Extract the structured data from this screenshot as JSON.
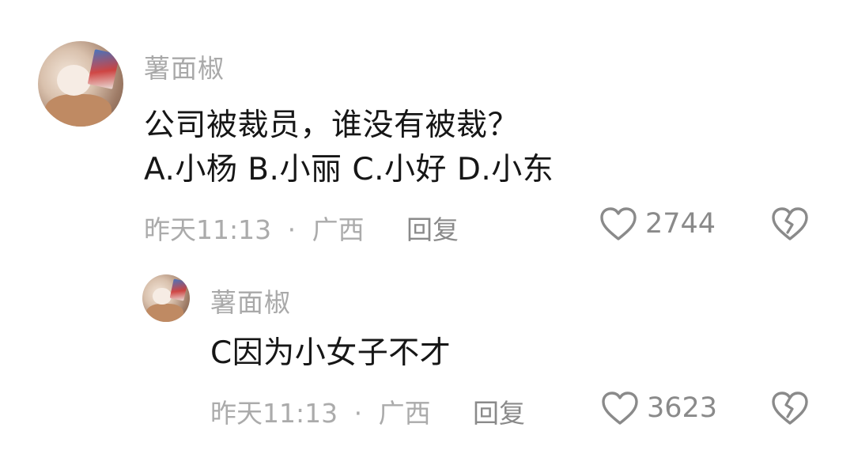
{
  "comments": [
    {
      "username": "薯面椒",
      "text_lines": [
        "公司被裁员，谁没有被裁？",
        "A.小杨 B.小丽 C.小好 D.小东"
      ],
      "time": "昨天11:13",
      "separator": "·",
      "location": "广西",
      "reply_label": "回复",
      "like_count": "2744"
    }
  ],
  "replies": [
    {
      "username": "薯面椒",
      "text": "C因为小女子不才",
      "time": "昨天11:13",
      "separator": "·",
      "location": "广西",
      "reply_label": "回复",
      "like_count": "3623"
    }
  ],
  "icons": {
    "like": "heart-outline-icon",
    "dislike": "broken-heart-icon"
  },
  "colors": {
    "username": "#a9a9a9",
    "text": "#161616",
    "meta": "#ababab",
    "action": "#8a8a8a"
  }
}
